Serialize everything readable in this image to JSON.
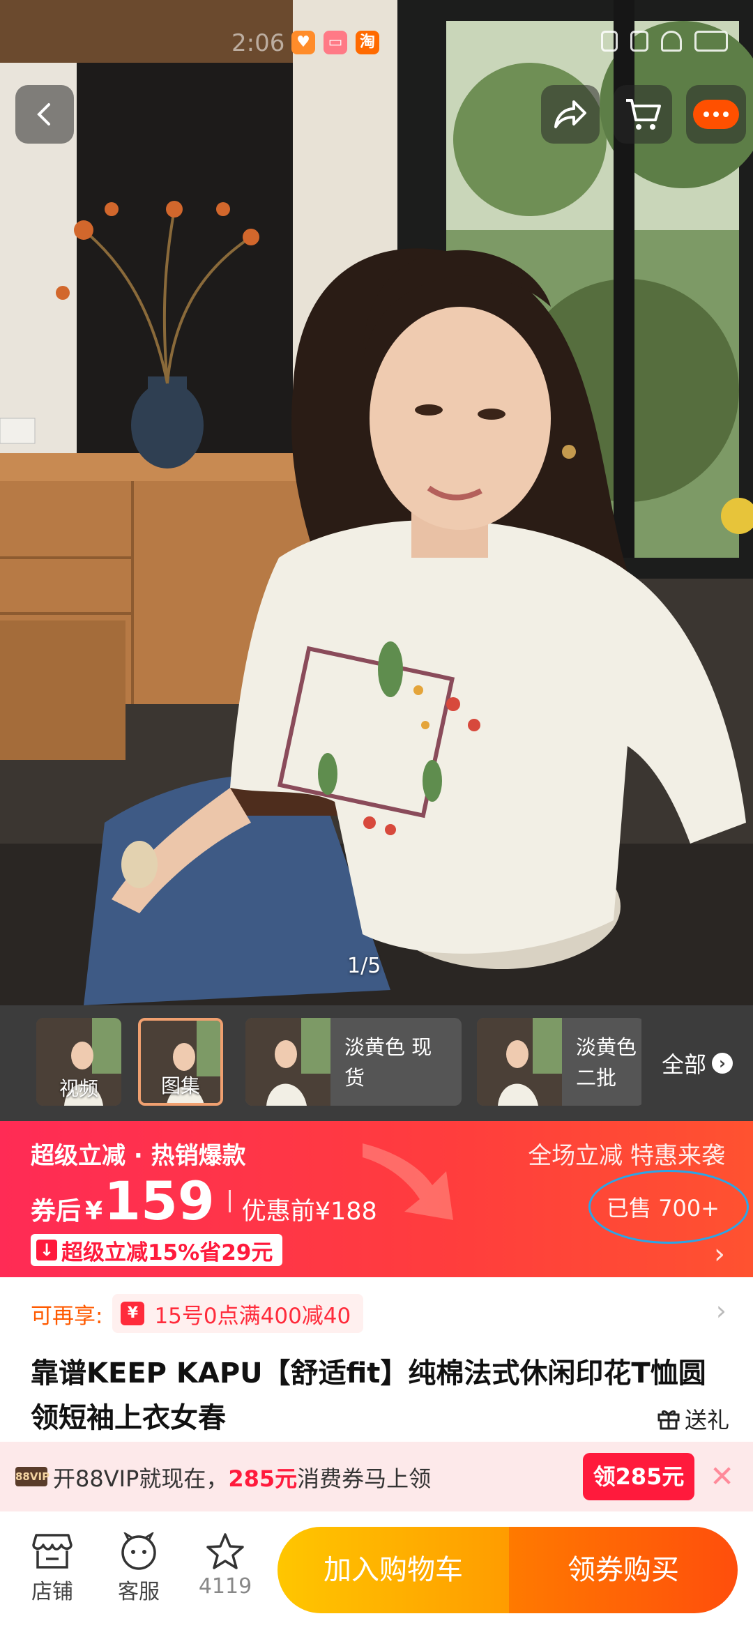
{
  "status_bar": {
    "time": "2:06",
    "app_icons": [
      "heart-app-icon",
      "gift-app-icon",
      "taobao-app-icon"
    ],
    "taobao_glyph": "淘"
  },
  "hero": {
    "image_counter": "1/5"
  },
  "thumbnails": [
    {
      "label": "视频",
      "type": "video"
    },
    {
      "label": "图集",
      "type": "gallery",
      "selected": true
    },
    {
      "label": "淡黄色 现货",
      "type": "variant"
    },
    {
      "label": "淡黄色 二批",
      "type": "variant"
    }
  ],
  "thumbnails_all_label": "全部",
  "price_banner": {
    "promo_title": "超级立减 · 热销爆款",
    "promo_right": "全场立减 特惠来袭",
    "price_prefix": "券后",
    "currency": "¥",
    "price": "159",
    "original_price": "优惠前¥188",
    "sold": "已售 700+",
    "discount_tag": "超级立减15%省29元"
  },
  "perk": {
    "label": "可再享:",
    "text": "15号0点满400减40"
  },
  "product": {
    "title": "靠谱KEEP KAPU【舒适fit】纯棉法式休闲印花T恤圆领短袖上衣女春",
    "gift_label": "送礼"
  },
  "vip_bar": {
    "badge": "88VIP",
    "text_before": "开88VIP就现在，",
    "amount": "285元",
    "text_after": "消费券马上领",
    "claim_label": "领285元"
  },
  "bottom_bar": {
    "store_label": "店铺",
    "service_label": "客服",
    "favorite_count": "4119",
    "add_to_cart": "加入购物车",
    "buy_with_coupon": "领券购买"
  },
  "colors": {
    "brand_orange": "#ff5000",
    "promo_red": "#ff2b55",
    "cart_yellow": "#ffc600",
    "sold_ring": "#2aa6e8"
  }
}
